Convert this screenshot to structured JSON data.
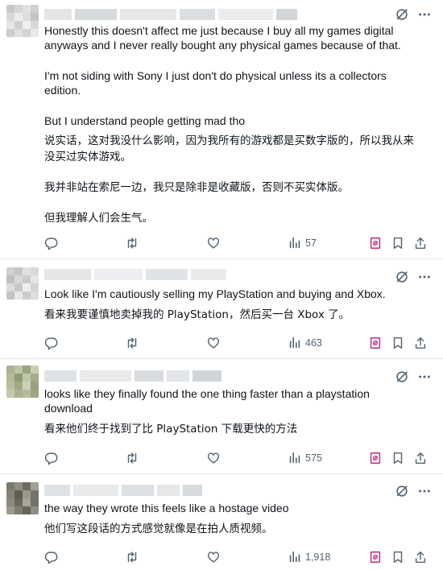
{
  "colors": {
    "text": "#0f1419",
    "muted": "#536471",
    "divider": "#e8ebed",
    "grok_bookmark": "#c2337a"
  },
  "icons": {
    "reply": "reply-icon",
    "retweet": "retweet-icon",
    "like": "heart-icon",
    "views": "views-bar-icon",
    "grok": "grok-slash-icon",
    "more": "more-dots-icon",
    "save": "bookmark-icon",
    "share": "share-icon",
    "grok_save": "grok-bookmark-icon"
  },
  "posts": [
    {
      "lines": [
        "Honestly this doesn't affect me just because I buy all my games digital",
        "anyways and I never really bought any physical games because of that.",
        "",
        "I'm not siding with Sony I just don't do physical unless its a collectors",
        "edition.",
        "",
        "But I understand people getting mad tho",
        "说实话，这对我没什么影响，因为我所有的游戏都是买数字版的，所以我从来",
        "没买过实体游戏。",
        "",
        "我并非站在索尼一边，我只是除非是收藏版，否则不买实体版。",
        "",
        "但我理解人们会生气。"
      ],
      "views": "57"
    },
    {
      "lines": [
        "Look like I'm cautiously selling my PlayStation and buying and Xbox.",
        "看来我要谨慎地卖掉我的 PlayStation，然后买一台 Xbox 了。"
      ],
      "views": "463"
    },
    {
      "lines": [
        "looks like they finally found the one thing faster than a playstation",
        "download",
        "看来他们终于找到了比 PlayStation 下载更快的方法"
      ],
      "views": "575"
    },
    {
      "lines": [
        "the way they wrote this feels like a hostage video",
        "他们写这段话的方式感觉就像是在拍人质视频。"
      ],
      "views": "1,918"
    }
  ]
}
